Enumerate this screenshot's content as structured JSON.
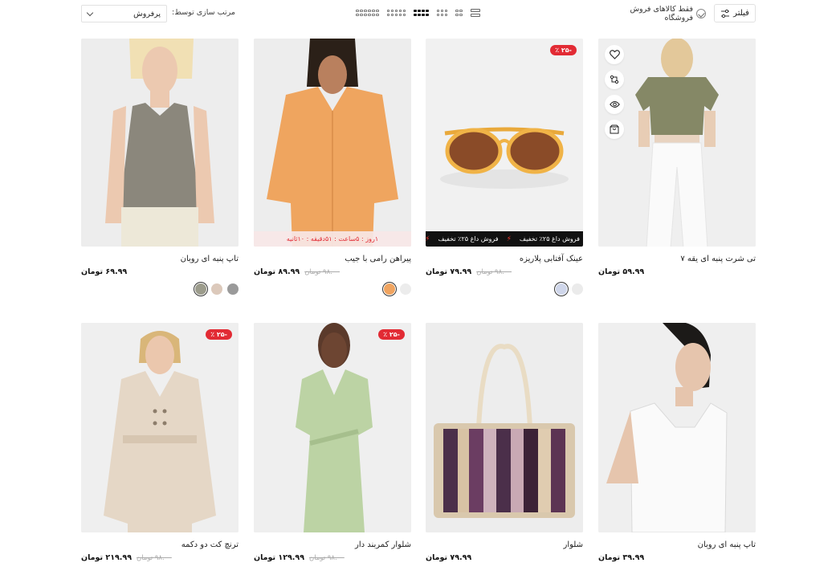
{
  "toolbar": {
    "filter_label": "فیلتر",
    "instock_label": "فقط کالاهای فروش فروشگاه",
    "sort_label": "مرتب سازی توسط:",
    "sort_value": "پرفروش"
  },
  "products": [
    {
      "title": "تی شرت پنبه ای یقه ۷",
      "price": "۵۹.۹۹ تومان",
      "old_price": "",
      "badge": "",
      "marquee": [],
      "countdown": "",
      "has_actions": true,
      "swatches": [],
      "image": "olive-tee"
    },
    {
      "title": "عینک آفتابی پلاریزه",
      "price": "۷۹.۹۹ تومان",
      "old_price": "۹۸.۰۰ تومان",
      "badge": "-۲۵ ٪",
      "marquee": [
        "فروش داغ ۲۵٪ تخفیف",
        "فروش داغ ۲۵٪ تخفیف",
        "فروش داغ ۲۵٪ تخفیف"
      ],
      "countdown": "",
      "has_actions": false,
      "swatches": [
        {
          "color": "#cfd6ea",
          "active": true
        },
        {
          "color": "#ebebeb",
          "active": false
        }
      ],
      "image": "sunglasses"
    },
    {
      "title": "پیراهن رامی با جیب",
      "price": "۸۹.۹۹ تومان",
      "old_price": "۹۸.۰۰ تومان",
      "badge": "",
      "marquee": [],
      "countdown": "۱روز : ۵ساعت : ۵۱دقیقه : ۱۰ثانیه",
      "has_actions": false,
      "swatches": [
        {
          "color": "#f0a460",
          "active": true
        },
        {
          "color": "#ececec",
          "active": false
        }
      ],
      "image": "orange-shirt"
    },
    {
      "title": "تاپ پنبه ای روبان",
      "price": "۶۹.۹۹ تومان",
      "old_price": "",
      "badge": "",
      "marquee": [],
      "countdown": "",
      "has_actions": false,
      "swatches": [
        {
          "color": "#9c9c8c",
          "active": true
        },
        {
          "color": "#dcc9bb",
          "active": false
        },
        {
          "color": "#9a9a9a",
          "active": false
        }
      ],
      "image": "gray-top"
    },
    {
      "title": "تاپ پنبه ای روبان",
      "price": "۳۹.۹۹ تومان",
      "old_price": "",
      "badge": "",
      "marquee": [],
      "countdown": "",
      "has_actions": false,
      "swatches": [],
      "image": "white-tank"
    },
    {
      "title": "شلوار",
      "price": "۷۹.۹۹ تومان",
      "old_price": "",
      "badge": "",
      "marquee": [],
      "countdown": "",
      "has_actions": false,
      "swatches": [],
      "image": "bag"
    },
    {
      "title": "شلوار کمربند دار",
      "price": "۱۲۹.۹۹ تومان",
      "old_price": "۹۸.۰۰ تومان",
      "badge": "-۲۵ ٪",
      "marquee": [],
      "countdown": "",
      "has_actions": false,
      "swatches": [],
      "image": "green-dress"
    },
    {
      "title": "ترنچ کت دو دکمه",
      "price": "۲۱۹.۹۹ تومان",
      "old_price": "۹۸.۰۰ تومان",
      "badge": "-۲۵ ٪",
      "marquee": [],
      "countdown": "",
      "has_actions": false,
      "swatches": [],
      "image": "trench"
    }
  ]
}
